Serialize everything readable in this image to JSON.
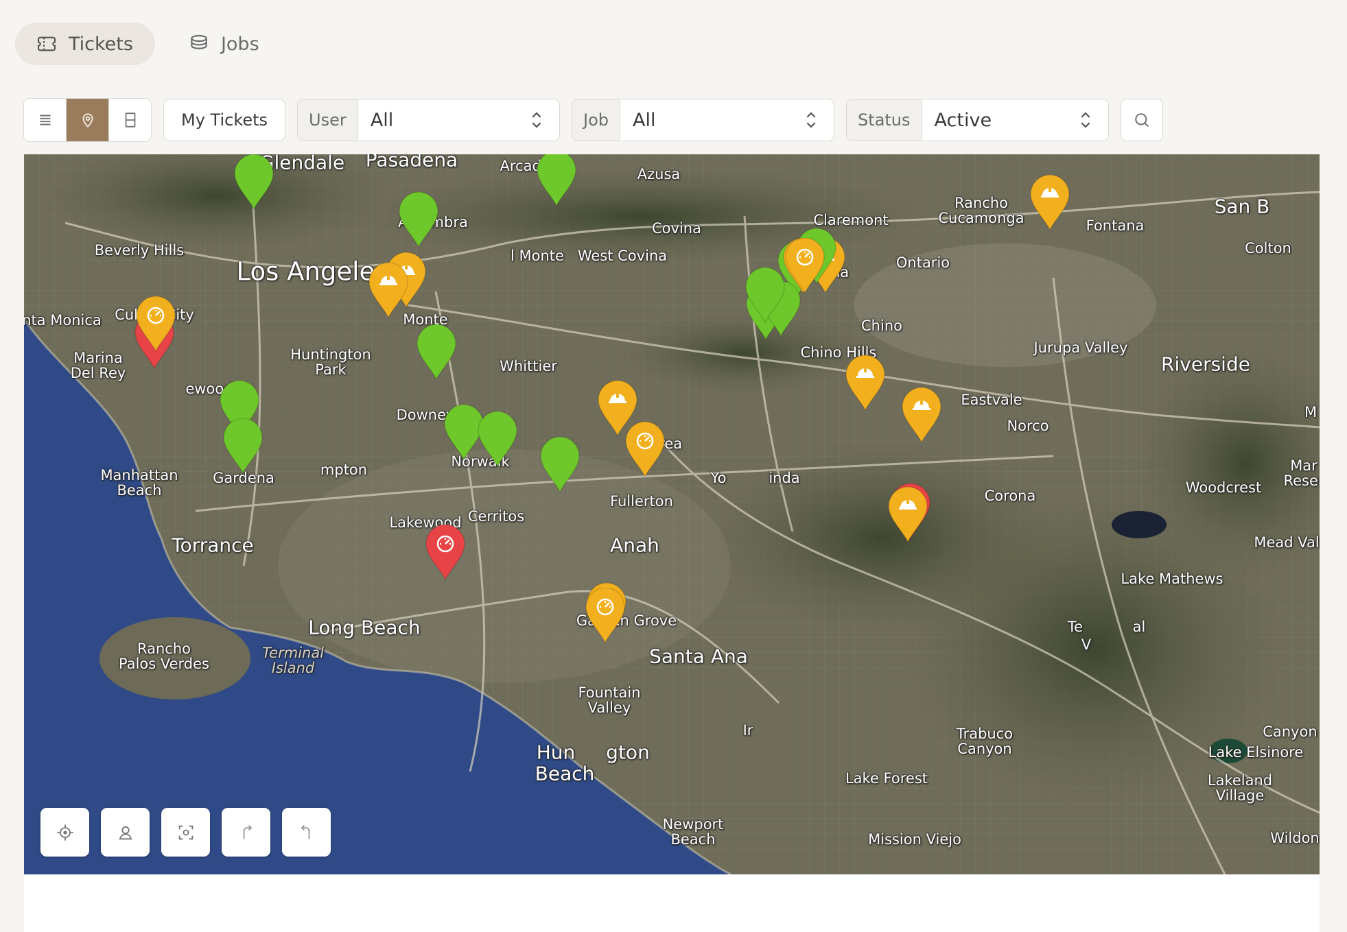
{
  "tabs": [
    {
      "label": "Tickets",
      "icon": "ticket-icon",
      "active": true
    },
    {
      "label": "Jobs",
      "icon": "layers-icon",
      "active": false
    }
  ],
  "toolbar": {
    "view_modes": [
      "list-icon",
      "map-pin-icon",
      "split-view-icon"
    ],
    "active_view": "map",
    "my_tickets_label": "My Tickets",
    "user_filter": {
      "label": "User",
      "value": "All"
    },
    "job_filter": {
      "label": "Job",
      "value": "All"
    },
    "status_filter": {
      "label": "Status",
      "value": "Active"
    }
  },
  "colors": {
    "accent": "#9a7b5b",
    "pin_green": "#6fc82b",
    "pin_yellow": "#f2b01e",
    "pin_red": "#e84347",
    "water": "#2f4a86"
  },
  "map": {
    "labels": [
      {
        "text": "Glendale"
      },
      {
        "text": "Pasadena"
      },
      {
        "text": "Arcadia"
      },
      {
        "text": "Azusa"
      },
      {
        "text": "Alhambra"
      },
      {
        "text": "Covina"
      },
      {
        "text": "Claremont"
      },
      {
        "text": "Rancho\nCucamonga"
      },
      {
        "text": "Fontana"
      },
      {
        "text": "San B"
      },
      {
        "text": "Colton"
      },
      {
        "text": "Beverly Hills"
      },
      {
        "text": "Los Angeles"
      },
      {
        "text": "l Monte"
      },
      {
        "text": "West Covina"
      },
      {
        "text": "Pomona"
      },
      {
        "text": "Ontario"
      },
      {
        "text": "nta Monica"
      },
      {
        "text": "Culver City"
      },
      {
        "text": "Monte"
      },
      {
        "text": "Chino"
      },
      {
        "text": "Marina\nDel Rey"
      },
      {
        "text": "Huntington\nPark"
      },
      {
        "text": "Chino Hills"
      },
      {
        "text": "Jurupa Valley"
      },
      {
        "text": "Riverside"
      },
      {
        "text": "ewood"
      },
      {
        "text": "Whittier"
      },
      {
        "text": "Eastvale"
      },
      {
        "text": "Downey"
      },
      {
        "text": "Norco"
      },
      {
        "text": "M"
      },
      {
        "text": "Brea"
      },
      {
        "text": "Manhattan\nBeach"
      },
      {
        "text": "Gardena"
      },
      {
        "text": "mpton"
      },
      {
        "text": "Norwalk"
      },
      {
        "text": "Yo"
      },
      {
        "text": "inda"
      },
      {
        "text": "Fullerton"
      },
      {
        "text": "Corona"
      },
      {
        "text": "Woodcrest"
      },
      {
        "text": "Mar\nReser"
      },
      {
        "text": "Lakewood"
      },
      {
        "text": "Cerritos"
      },
      {
        "text": "Torrance"
      },
      {
        "text": "Anah"
      },
      {
        "text": "Mead Val"
      },
      {
        "text": "Lake Mathews"
      },
      {
        "text": "Long Beach"
      },
      {
        "text": "Garden Grove"
      },
      {
        "text": "Rancho\nPalos Verdes"
      },
      {
        "text": "Terminal\nIsland"
      },
      {
        "text": "Santa Ana"
      },
      {
        "text": "Te"
      },
      {
        "text": "al"
      },
      {
        "text": "V"
      },
      {
        "text": "Fountain\nValley"
      },
      {
        "text": "Trabuco\nCanyon"
      },
      {
        "text": "Canyon"
      },
      {
        "text": "Hun"
      },
      {
        "text": "gton"
      },
      {
        "text": "Beach"
      },
      {
        "text": "Ir"
      },
      {
        "text": "Lake Elsinore"
      },
      {
        "text": "Lake Forest"
      },
      {
        "text": "Lakeland\nVillage"
      },
      {
        "text": "Newport\nBeach"
      },
      {
        "text": "Mission Viejo"
      },
      {
        "text": "Wildon"
      }
    ],
    "pins": [
      {
        "status": "green",
        "icon": "none"
      },
      {
        "status": "green",
        "icon": "none"
      },
      {
        "status": "green",
        "icon": "none"
      },
      {
        "status": "yellow",
        "icon": "hardhat-icon"
      },
      {
        "status": "yellow",
        "icon": "hardhat-icon"
      },
      {
        "status": "red",
        "icon": "none"
      },
      {
        "status": "yellow",
        "icon": "gauge-icon"
      },
      {
        "status": "green",
        "icon": "none"
      },
      {
        "status": "yellow",
        "icon": "hardhat-icon"
      },
      {
        "status": "green",
        "icon": "none"
      },
      {
        "status": "green",
        "icon": "none"
      },
      {
        "status": "green",
        "icon": "none"
      },
      {
        "status": "yellow",
        "icon": "hardhat-icon"
      },
      {
        "status": "green",
        "icon": "none"
      },
      {
        "status": "green",
        "icon": "none"
      },
      {
        "status": "yellow",
        "icon": "hardhat-icon"
      },
      {
        "status": "yellow",
        "icon": "gauge-icon"
      },
      {
        "status": "green",
        "icon": "none"
      },
      {
        "status": "red",
        "icon": "gauge-icon"
      },
      {
        "status": "yellow",
        "icon": "gauge-icon"
      },
      {
        "status": "yellow",
        "icon": "hardhat-icon"
      },
      {
        "status": "green",
        "icon": "none"
      },
      {
        "status": "green",
        "icon": "none"
      },
      {
        "status": "yellow",
        "icon": "hardhat-icon"
      },
      {
        "status": "yellow",
        "icon": "hardhat-icon"
      },
      {
        "status": "green",
        "icon": "none"
      },
      {
        "status": "green",
        "icon": "none"
      },
      {
        "status": "yellow",
        "icon": "gauge-icon"
      },
      {
        "status": "yellow",
        "icon": "gauge-icon"
      },
      {
        "status": "red",
        "icon": "none"
      },
      {
        "status": "yellow",
        "icon": "hardhat-icon"
      }
    ],
    "controls": [
      "locate-icon",
      "user-location-icon",
      "focus-icon",
      "redo-icon",
      "undo-icon"
    ]
  }
}
